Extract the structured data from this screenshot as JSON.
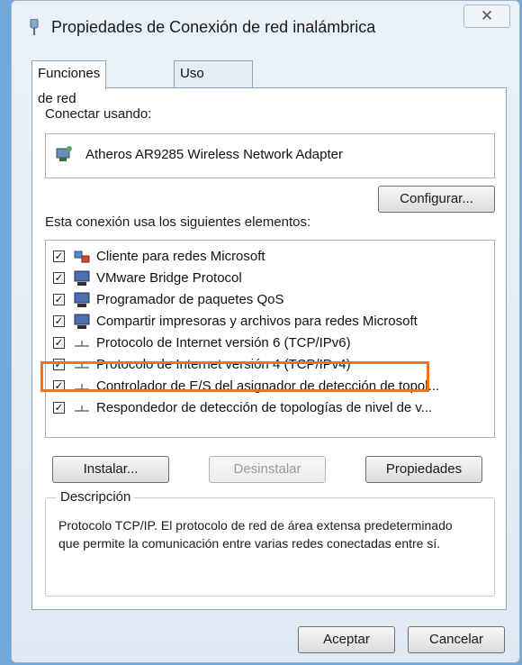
{
  "window": {
    "title": "Propiedades de Conexión de red inalámbrica",
    "close_label": "✕"
  },
  "tabs": [
    {
      "label": "Funciones de red",
      "active": true
    },
    {
      "label": "Uso compartido",
      "active": false
    }
  ],
  "connect": {
    "label": "Conectar usando:",
    "adapter": "Atheros AR9285 Wireless Network Adapter",
    "adapter_icon": "network-adapter-icon",
    "configure_label": "Configurar..."
  },
  "items_label": "Esta conexión usa los siguientes elementos:",
  "items": [
    {
      "label": "Cliente para redes Microsoft",
      "checked": true,
      "icon": "client-network-icon"
    },
    {
      "label": "VMware Bridge Protocol",
      "checked": true,
      "icon": "service-computer-icon"
    },
    {
      "label": "Programador de paquetes QoS",
      "checked": true,
      "icon": "service-computer-icon"
    },
    {
      "label": "Compartir impresoras y archivos para redes Microsoft",
      "checked": true,
      "icon": "service-computer-icon"
    },
    {
      "label": "Protocolo de Internet versión 6 (TCP/IPv6)",
      "checked": true,
      "icon": "protocol-icon"
    },
    {
      "label": "Protocolo de Internet versión 4 (TCP/IPv4)",
      "checked": true,
      "icon": "protocol-icon",
      "highlighted": true
    },
    {
      "label": "Controlador de E/S del asignador de detección de topol...",
      "checked": true,
      "icon": "protocol-icon"
    },
    {
      "label": "Respondedor de detección de topologías de nivel de v...",
      "checked": true,
      "icon": "protocol-icon"
    }
  ],
  "buttons": {
    "install": "Instalar...",
    "uninstall": "Desinstalar",
    "properties": "Propiedades",
    "ok": "Aceptar",
    "cancel": "Cancelar"
  },
  "description": {
    "legend": "Descripción",
    "text": "Protocolo TCP/IP. El protocolo de red de área extensa predeterminado que permite la comunicación entre varias redes conectadas entre sí."
  },
  "colors": {
    "highlight": "#e8742a",
    "window_bg": "#dfe9f3"
  }
}
